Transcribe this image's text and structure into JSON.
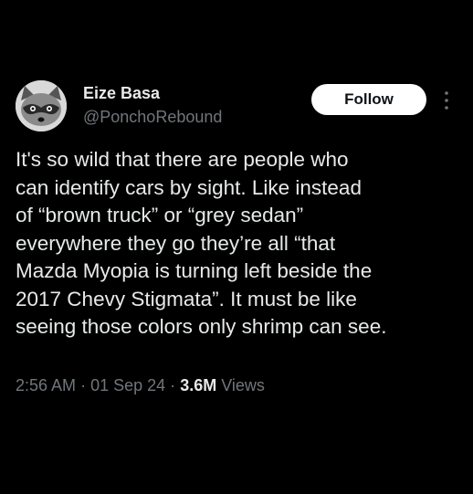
{
  "author": {
    "display_name": "Eize Basa",
    "handle": "@PonchoRebound",
    "avatar_icon": "raccoon-avatar-icon"
  },
  "actions": {
    "follow_label": "Follow",
    "more_icon": "vertical-ellipsis-icon"
  },
  "tweet": {
    "lines": [
      "It's so wild that there are people who",
      "can identify cars by sight. Like instead",
      "of “brown truck” or “grey sedan”",
      "everywhere they go they’re all “that",
      "Mazda Myopia is turning left beside the",
      "2017 Chevy Stigmata”. It must be like",
      "seeing those colors only shrimp can see."
    ]
  },
  "meta": {
    "time": "2:56 AM",
    "separator": "·",
    "date": "01 Sep 24",
    "views_count": "3.6M",
    "views_label": "Views"
  },
  "colors": {
    "background": "#000000",
    "primary_text": "#e7e9ea",
    "secondary_text": "#71767b",
    "follow_button_bg": "#ffffff",
    "follow_button_text": "#0f1419"
  }
}
